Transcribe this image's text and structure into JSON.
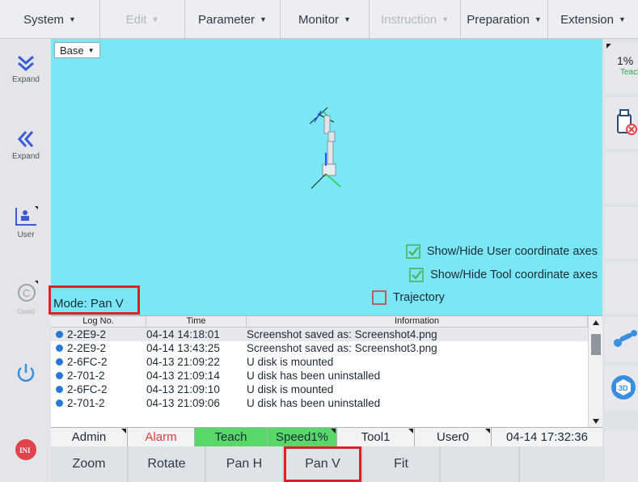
{
  "menu": [
    {
      "label": "System",
      "enabled": true
    },
    {
      "label": "Edit",
      "enabled": false
    },
    {
      "label": "Parameter",
      "enabled": true
    },
    {
      "label": "Monitor",
      "enabled": true
    },
    {
      "label": "Instruction",
      "enabled": false
    },
    {
      "label": "Preparation",
      "enabled": true
    },
    {
      "label": "Extension",
      "enabled": true
    }
  ],
  "left": {
    "expand1": "Expand",
    "expand2": "Expand",
    "user": "User",
    "coord": "Coord"
  },
  "viewport": {
    "base_select": "Base",
    "mode": "Mode: Pan V",
    "opt_user_axes": "Show/Hide User coordinate axes",
    "opt_tool_axes": "Show/Hide Tool coordinate axes",
    "opt_trajectory": "Trajectory"
  },
  "log": {
    "headers": {
      "no": "Log No.",
      "time": "Time",
      "info": "Information"
    },
    "rows": [
      {
        "no": "2-2E9-2",
        "time": "04-14 14:18:01",
        "info": "Screenshot saved as: Screenshot4.png"
      },
      {
        "no": "2-2E9-2",
        "time": "04-14 13:43:25",
        "info": "Screenshot saved as: Screenshot3.png"
      },
      {
        "no": "2-6FC-2",
        "time": "04-13 21:09:22",
        "info": "U disk is mounted"
      },
      {
        "no": "2-701-2",
        "time": "04-13 21:09:14",
        "info": "U disk has been uninstalled"
      },
      {
        "no": "2-6FC-2",
        "time": "04-13 21:09:10",
        "info": "U disk is mounted"
      },
      {
        "no": "2-701-2",
        "time": "04-13 21:09:06",
        "info": "U disk has been uninstalled"
      }
    ]
  },
  "status": {
    "user": "Admin",
    "alarm": "Alarm",
    "mode": "Teach",
    "speed": "Speed1%",
    "tool": "Tool1",
    "coord": "User0",
    "datetime": "04-14 17:32:36"
  },
  "bottom": [
    "Zoom",
    "Rotate",
    "Pan H",
    "Pan V",
    "Fit"
  ],
  "right": {
    "speed": "1%",
    "mode": "Teach"
  },
  "colors": {
    "viewport_bg": "#7ae7f5",
    "active_green": "#59d86a",
    "highlight_red": "#e01f26",
    "info_dot": "#2a78d6"
  }
}
